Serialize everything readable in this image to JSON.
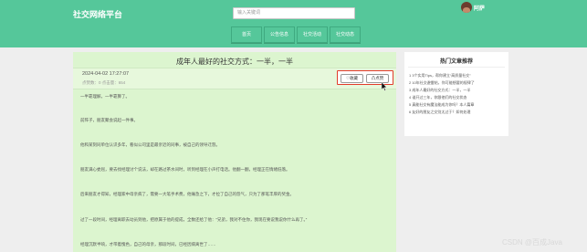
{
  "header": {
    "brand": "社交网络平台",
    "search_placeholder": "输入关键词",
    "username": "阿萨",
    "nav": [
      "首页",
      "公告信息",
      "社交活动",
      "社交动态"
    ]
  },
  "article": {
    "title": "成年人最好的社交方式：一半，一半",
    "date": "2024-04-02 17:27:07",
    "stats": "点赞数：0   点击量：654",
    "fav_label": "♡收藏",
    "like_label": "凸点赞",
    "paragraphs": [
      "一半靠理解，一半靠算了。",
      "前阵子，朋友聚会说起一件事。",
      "他和某刻同单位认识多年，看似公司里是最亲近的同事，被自己的领导迁怒。",
      "朋友满心委屈，要去找经理讨个说法，却在路过茶水间时，听到经理在小声打电话。他翻一翻，经理正在情绪低落。",
      "后来朋友才得知，经理家中母亲病了，需要一大笔手术费，他痛急之下，才拉了自己的怨气，只为了那笔丰厚的奖金。",
      "过了一段时间，经理离职去动员到他，把原属于他的提成，全数还给了他：“兄弟，我对不住你，我现在要说我说你什么再了。”",
      "经理沉默半响，才带着愧色，自己的母亲，那段时间，已经因病离世了……"
    ]
  },
  "sidebar": {
    "title": "热门文章推荐",
    "items": [
      "1 3个实用Tips，帮你建立“高质量社交”",
      "2 10年社交避雷帖，你可能想要的规律了",
      "3 成年人最好的社交方式：一半，一半",
      "4 谁开过三年，你跟他们的社交状态",
      "5 真能社交有魔法能成为你吗？本人篇章",
      "6 友好的朋友之交别太过于？如何处理"
    ]
  },
  "watermark": "CSDN @百成Java"
}
